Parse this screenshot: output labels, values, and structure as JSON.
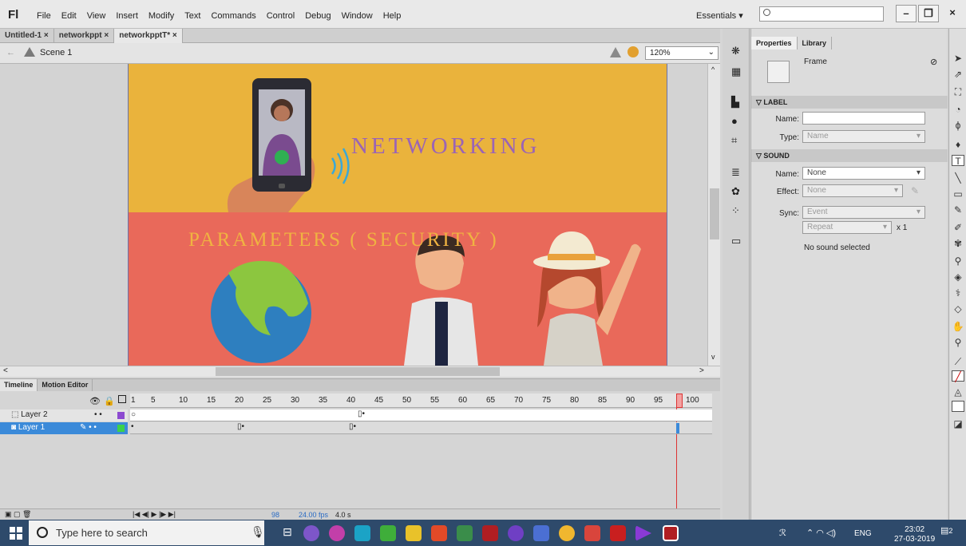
{
  "app": {
    "logo": "Fl"
  },
  "menu": [
    "File",
    "Edit",
    "View",
    "Insert",
    "Modify",
    "Text",
    "Commands",
    "Control",
    "Debug",
    "Window",
    "Help"
  ],
  "workspace": {
    "label": "Essentials",
    "caret": "▾"
  },
  "window_controls": {
    "minimize": "–",
    "restore": "❐",
    "close": "×"
  },
  "doc_tabs": [
    {
      "label": "Untitled-1 ×"
    },
    {
      "label": "networkppt ×"
    },
    {
      "label": "networkpptT* ×"
    }
  ],
  "scene": {
    "label": "Scene 1",
    "zoom": "120%"
  },
  "stage": {
    "title": "NETWORKING",
    "subtitle": "PARAMETERS ( SECURITY )",
    "colors": {
      "top": "#eab33c",
      "bottom": "#e9695a",
      "title": "#9b64b5",
      "subtitle": "#f0b341"
    }
  },
  "properties": {
    "tabs": [
      "Properties",
      "Library"
    ],
    "frame_label": "Frame",
    "label_section": "LABEL",
    "name_label": "Name:",
    "name_value": "",
    "type_label": "Type:",
    "type_value": "Name",
    "sound_section": "SOUND",
    "sound_name_label": "Name:",
    "sound_name_value": "None",
    "effect_label": "Effect:",
    "effect_value": "None",
    "sync_label": "Sync:",
    "sync_value": "Event",
    "repeat_value": "Repeat",
    "repeat_times": "x 1",
    "status": "No sound selected"
  },
  "timeline": {
    "tabs": [
      "Timeline",
      "Motion Editor"
    ],
    "ruler": [
      "1",
      "5",
      "10",
      "15",
      "20",
      "25",
      "30",
      "35",
      "40",
      "45",
      "50",
      "55",
      "60",
      "65",
      "70",
      "75",
      "80",
      "85",
      "90",
      "95",
      "100"
    ],
    "layers": [
      {
        "name": "Layer 2"
      },
      {
        "name": "Layer 1"
      }
    ],
    "footer": {
      "frame": "98",
      "fps": "24.00 fps",
      "time": "4.0 s"
    }
  },
  "taskbar": {
    "search_placeholder": "Type here to search",
    "language": "ENG",
    "time": "23:02",
    "date": "27-03-2019",
    "notif_count": "2"
  }
}
